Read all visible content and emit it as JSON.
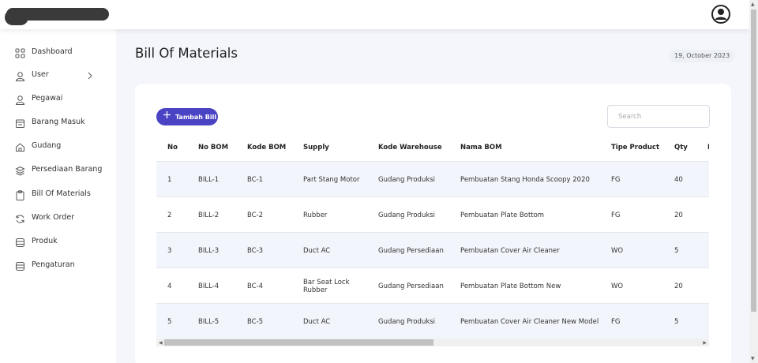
{
  "header": {
    "avatar": "user-circle-icon"
  },
  "sidebar": {
    "items": [
      {
        "label": "Dashboard",
        "icon": "grid-icon"
      },
      {
        "label": "User",
        "icon": "user-icon",
        "has_submenu": true
      },
      {
        "label": "Pegawai",
        "icon": "person-icon"
      },
      {
        "label": "Barang Masuk",
        "icon": "inbox-icon"
      },
      {
        "label": "Gudang",
        "icon": "home-icon"
      },
      {
        "label": "Persediaan Barang",
        "icon": "layers-icon"
      },
      {
        "label": "Bill Of Materials",
        "icon": "clipboard-icon"
      },
      {
        "label": "Work Order",
        "icon": "refresh-icon"
      },
      {
        "label": "Produk",
        "icon": "database-icon"
      },
      {
        "label": "Pengaturan",
        "icon": "database-icon"
      }
    ]
  },
  "main": {
    "title": "Bill Of Materials",
    "date": "19, October 2023",
    "add_button": "Tambah Bill",
    "search_placeholder": "Search",
    "accent": "#4a43c4"
  },
  "table": {
    "headers": [
      "No",
      "No BOM",
      "Kode BOM",
      "Supply",
      "Kode Warehouse",
      "Nama BOM",
      "Tipe Product",
      "Qty"
    ],
    "rows": [
      {
        "no": "1",
        "no_bom": "BILL-1",
        "kode_bom": "BC-1",
        "supply": "Part Stang Motor",
        "kode_warehouse": "Gudang Produksi",
        "nama_bom": "Pembuatan Stang Honda Scoopy 2020",
        "tipe": "FG",
        "qty": "40"
      },
      {
        "no": "2",
        "no_bom": "BILL-2",
        "kode_bom": "BC-2",
        "supply": "Rubber",
        "kode_warehouse": "Gudang Produksi",
        "nama_bom": "Pembuatan Plate Bottom",
        "tipe": "FG",
        "qty": "20"
      },
      {
        "no": "3",
        "no_bom": "BILL-3",
        "kode_bom": "BC-3",
        "supply": "Duct AC",
        "kode_warehouse": "Gudang Persediaan",
        "nama_bom": "Pembuatan Cover Air Cleaner",
        "tipe": "WO",
        "qty": "5"
      },
      {
        "no": "4",
        "no_bom": "BILL-4",
        "kode_bom": "BC-4",
        "supply": "Bar Seat Lock Rubber",
        "kode_warehouse": "Gudang Persediaan",
        "nama_bom": "Pembuatan Plate Bottom New",
        "tipe": "WO",
        "qty": "20"
      },
      {
        "no": "5",
        "no_bom": "BILL-5",
        "kode_bom": "BC-5",
        "supply": "Duct AC",
        "kode_warehouse": "Gudang Produksi",
        "nama_bom": "Pembuatan Cover Air Cleaner New Model",
        "tipe": "FG",
        "qty": "5"
      }
    ]
  }
}
